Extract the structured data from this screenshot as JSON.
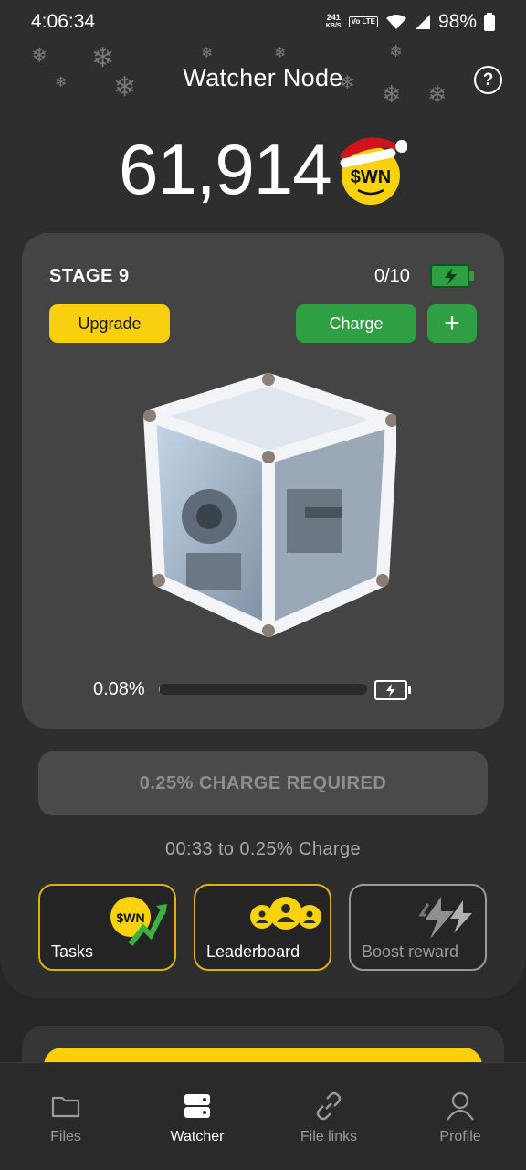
{
  "status_bar": {
    "time": "4:06:34",
    "net_speed_value": "241",
    "net_speed_unit": "KB/S",
    "volte_tag": "Vo LTE",
    "battery_pct": "98%"
  },
  "header": {
    "title": "Watcher Node",
    "help_icon": "?"
  },
  "balance": {
    "amount": "61,914",
    "coin_label": "$WN"
  },
  "stage": {
    "label": "STAGE 9",
    "charge_count": "0/10",
    "upgrade_label": "Upgrade",
    "charge_label": "Charge",
    "plus_label": "+",
    "progress_text": "0.08%",
    "progress_value": 0.0008
  },
  "charge_required": {
    "label": "0.25% CHARGE REQUIRED",
    "timer_text": "00:33 to 0.25% Charge"
  },
  "actions": [
    {
      "label": "Tasks",
      "icon": "wn-coin-arrow-icon"
    },
    {
      "label": "Leaderboard",
      "icon": "people-icon"
    },
    {
      "label": "Boost reward",
      "icon": "lightning-icon"
    }
  ],
  "nav": [
    {
      "label": "Files",
      "icon": "folder-icon"
    },
    {
      "label": "Watcher",
      "icon": "server-icon"
    },
    {
      "label": "File links",
      "icon": "link-icon"
    },
    {
      "label": "Profile",
      "icon": "user-icon"
    }
  ],
  "colors": {
    "accent_yellow": "#f8d00e",
    "accent_green": "#2ea043",
    "background": "#262626"
  }
}
